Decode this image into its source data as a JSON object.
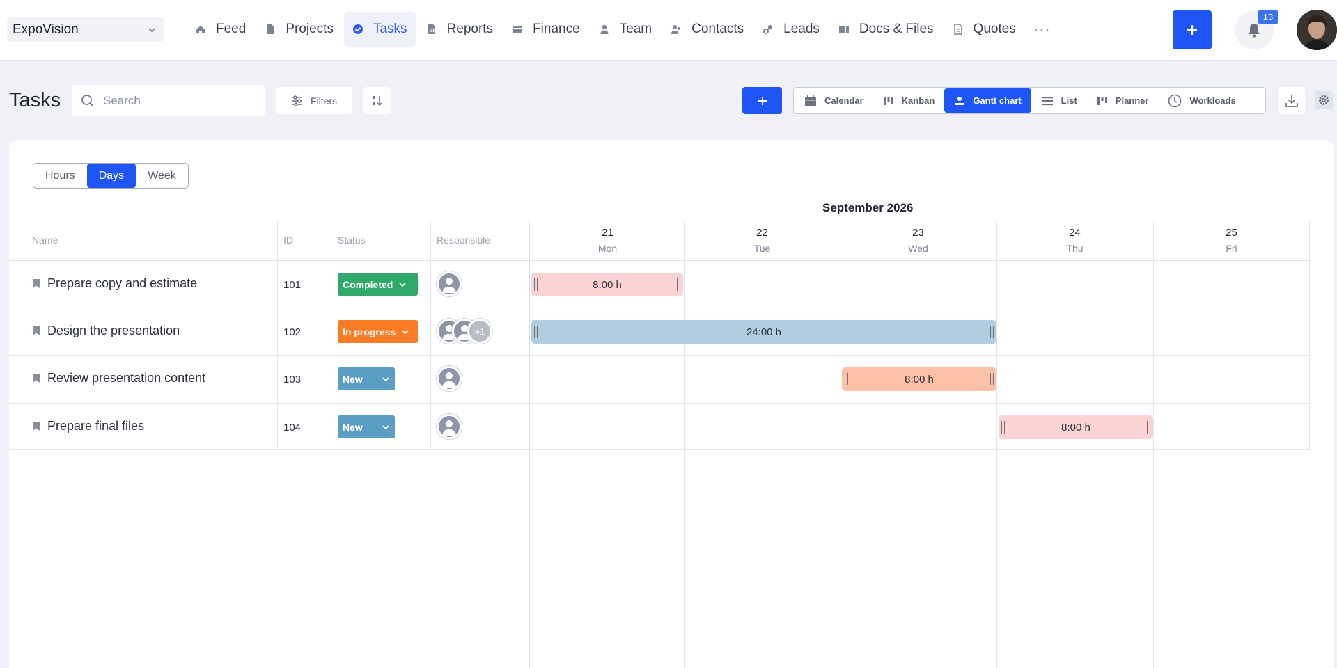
{
  "workspace": {
    "name": "ExpoVision"
  },
  "nav": [
    {
      "label": "Feed",
      "icon": "home-icon"
    },
    {
      "label": "Projects",
      "icon": "document-icon"
    },
    {
      "label": "Tasks",
      "icon": "check-circle-icon",
      "active": true
    },
    {
      "label": "Reports",
      "icon": "report-icon"
    },
    {
      "label": "Finance",
      "icon": "wallet-icon"
    },
    {
      "label": "Team",
      "icon": "person-icon"
    },
    {
      "label": "Contacts",
      "icon": "contacts-icon"
    },
    {
      "label": "Leads",
      "icon": "link-icon"
    },
    {
      "label": "Docs & Files",
      "icon": "folder-icon"
    },
    {
      "label": "Quotes",
      "icon": "quote-doc-icon"
    }
  ],
  "nav_more": "···",
  "notifications": {
    "count": "13"
  },
  "page": {
    "title": "Tasks",
    "search_placeholder": "Search",
    "filters_label": "Filters"
  },
  "views": [
    {
      "label": "Calendar",
      "icon": "calendar-icon"
    },
    {
      "label": "Kanban",
      "icon": "kanban-icon"
    },
    {
      "label": "Gantt chart",
      "icon": "gantt-icon",
      "active": true
    },
    {
      "label": "List",
      "icon": "list-icon"
    },
    {
      "label": "Planner",
      "icon": "planner-icon"
    },
    {
      "label": "Workloads",
      "icon": "clock-icon"
    }
  ],
  "scale": {
    "options": [
      "Hours",
      "Days",
      "Week"
    ],
    "selected": "Days"
  },
  "gantt": {
    "month": "September 2026",
    "columns": {
      "name": "Name",
      "id": "ID",
      "status": "Status",
      "responsible": "Responsible"
    },
    "days": [
      {
        "num": "21",
        "name": "Mon"
      },
      {
        "num": "22",
        "name": "Tue"
      },
      {
        "num": "23",
        "name": "Wed"
      },
      {
        "num": "24",
        "name": "Thu"
      },
      {
        "num": "25",
        "name": "Fri"
      }
    ],
    "tasks": [
      {
        "name": "Prepare copy and estimate",
        "id": "101",
        "status": "Completed",
        "assignee_extra": "",
        "bar": {
          "label": "8:00 h",
          "start": "21",
          "end": "21",
          "color": "#fcd3d3"
        }
      },
      {
        "name": "Design the presentation",
        "id": "102",
        "status": "In progress",
        "assignee_extra": "+1",
        "bar": {
          "label": "24:00 h",
          "start": "21",
          "end": "23",
          "color": "#b1cddf"
        }
      },
      {
        "name": "Review presentation content",
        "id": "103",
        "status": "New",
        "assignee_extra": "",
        "bar": {
          "label": "8:00 h",
          "start": "23",
          "end": "23",
          "color": "#fdc1a7"
        }
      },
      {
        "name": "Prepare final files",
        "id": "104",
        "status": "New",
        "assignee_extra": "",
        "bar": {
          "label": "8:00 h",
          "start": "24",
          "end": "24",
          "color": "#fcd3d3"
        }
      }
    ]
  },
  "colors": {
    "accent": "#1f55f5",
    "completed": "#2fa86a",
    "in_progress": "#fb7c26",
    "new": "#5a9ec4"
  }
}
